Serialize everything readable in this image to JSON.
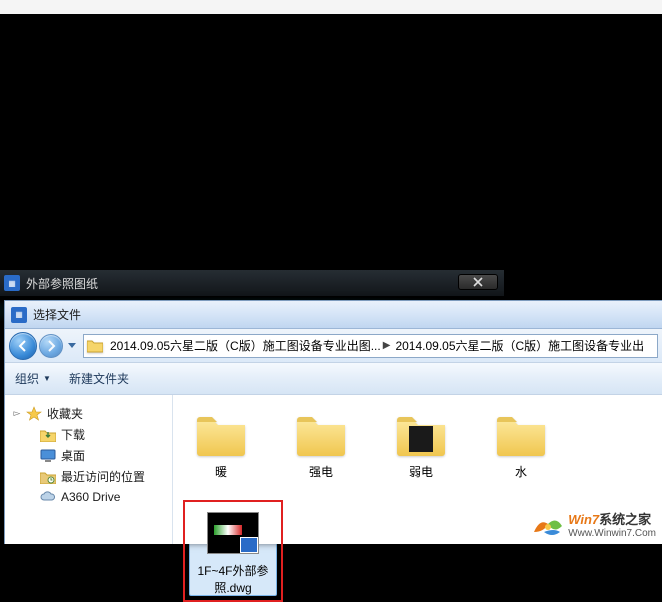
{
  "xref_panel": {
    "title": "外部参照图纸"
  },
  "explorer": {
    "title": "选择文件",
    "faded_hint": "",
    "breadcrumb": [
      {
        "label": "2014.09.05六星二版（C版）施工图设备专业出图..."
      },
      {
        "label": "2014.09.05六星二版（C版）施工图设备专业出"
      }
    ],
    "toolbar": {
      "organize": "组织",
      "new_folder": "新建文件夹"
    },
    "sidebar": {
      "favorites": "收藏夹",
      "items": [
        {
          "label": "下载",
          "icon": "download"
        },
        {
          "label": "桌面",
          "icon": "desktop"
        },
        {
          "label": "最近访问的位置",
          "icon": "recent"
        },
        {
          "label": "A360 Drive",
          "icon": "a360"
        }
      ]
    },
    "files": [
      {
        "name": "暖",
        "type": "folder"
      },
      {
        "name": "强电",
        "type": "folder"
      },
      {
        "name": "弱电",
        "type": "folder-dark"
      },
      {
        "name": "水",
        "type": "folder"
      },
      {
        "name": "1F~4F外部参照.dwg",
        "type": "dwg",
        "selected": true
      }
    ]
  },
  "watermark": {
    "line1_a": "Win7",
    "line1_b": "系统之家",
    "line2": "Www.Winwin7.Com"
  }
}
